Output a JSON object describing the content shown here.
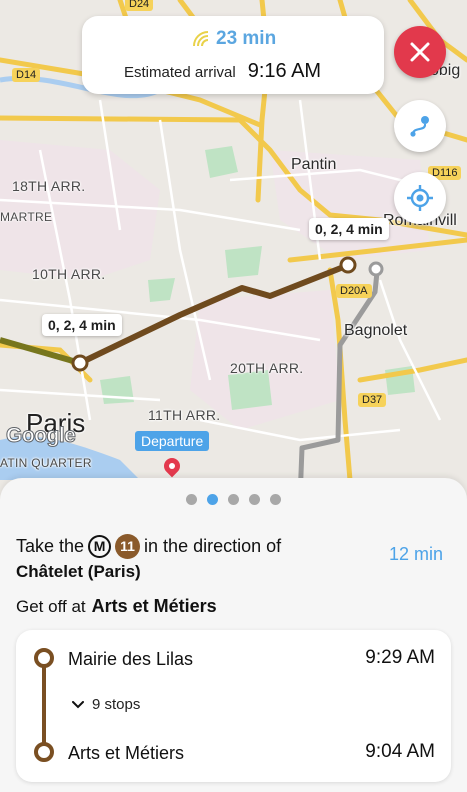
{
  "colors": {
    "accent_blue": "#4da3e8",
    "close_red": "#e2394c",
    "line_11_brown": "#7a4f22",
    "route_olive": "#7a7a1e",
    "walk_grey": "#9a9a9a"
  },
  "eta": {
    "icon": "live-signal-icon",
    "duration": "23 min",
    "arrival_label": "Estimated arrival",
    "arrival_time": "9:16 AM"
  },
  "controls": {
    "close_icon": "close-icon",
    "route_icon": "route-icon",
    "locate_icon": "my-location-icon"
  },
  "map": {
    "labels": {
      "d24": "D24",
      "d14": "D14",
      "bobigny_partial": "obig",
      "pantin": "Pantin",
      "d116": "D116",
      "romainville_partial": "Romainvill",
      "arr18": "18TH ARR.",
      "montmartre_partial": "MARTRE",
      "arr10": "10TH ARR.",
      "d20a": "D20A",
      "bagnolet": "Bagnolet",
      "arr20": "20TH ARR.",
      "d37": "D37",
      "paris": "Paris",
      "arr11": "11TH ARR.",
      "latin_quarter_partial": "ATIN QUARTER"
    },
    "frequency_tags": [
      "0, 2, 4 min",
      "0, 2, 4 min"
    ],
    "departure_label": "Departure",
    "attribution": "Google"
  },
  "sheet": {
    "pager": {
      "count": 5,
      "active": 1
    },
    "instruction": {
      "take": "Take the",
      "metro_symbol": "M",
      "line_number": "11",
      "direction_text": "in the direction of",
      "destination": "Châtelet (Paris)"
    },
    "step_duration": "12 min",
    "get_off_label": "Get off at",
    "get_off_stop": "Arts et Métiers",
    "stops": {
      "from": {
        "name": "Mairie des Lilas",
        "time": "9:29 AM"
      },
      "intermediate": "9 stops",
      "toggle_icon": "chevron-down-icon",
      "to": {
        "name": "Arts et Métiers",
        "time": "9:04 AM"
      }
    }
  }
}
